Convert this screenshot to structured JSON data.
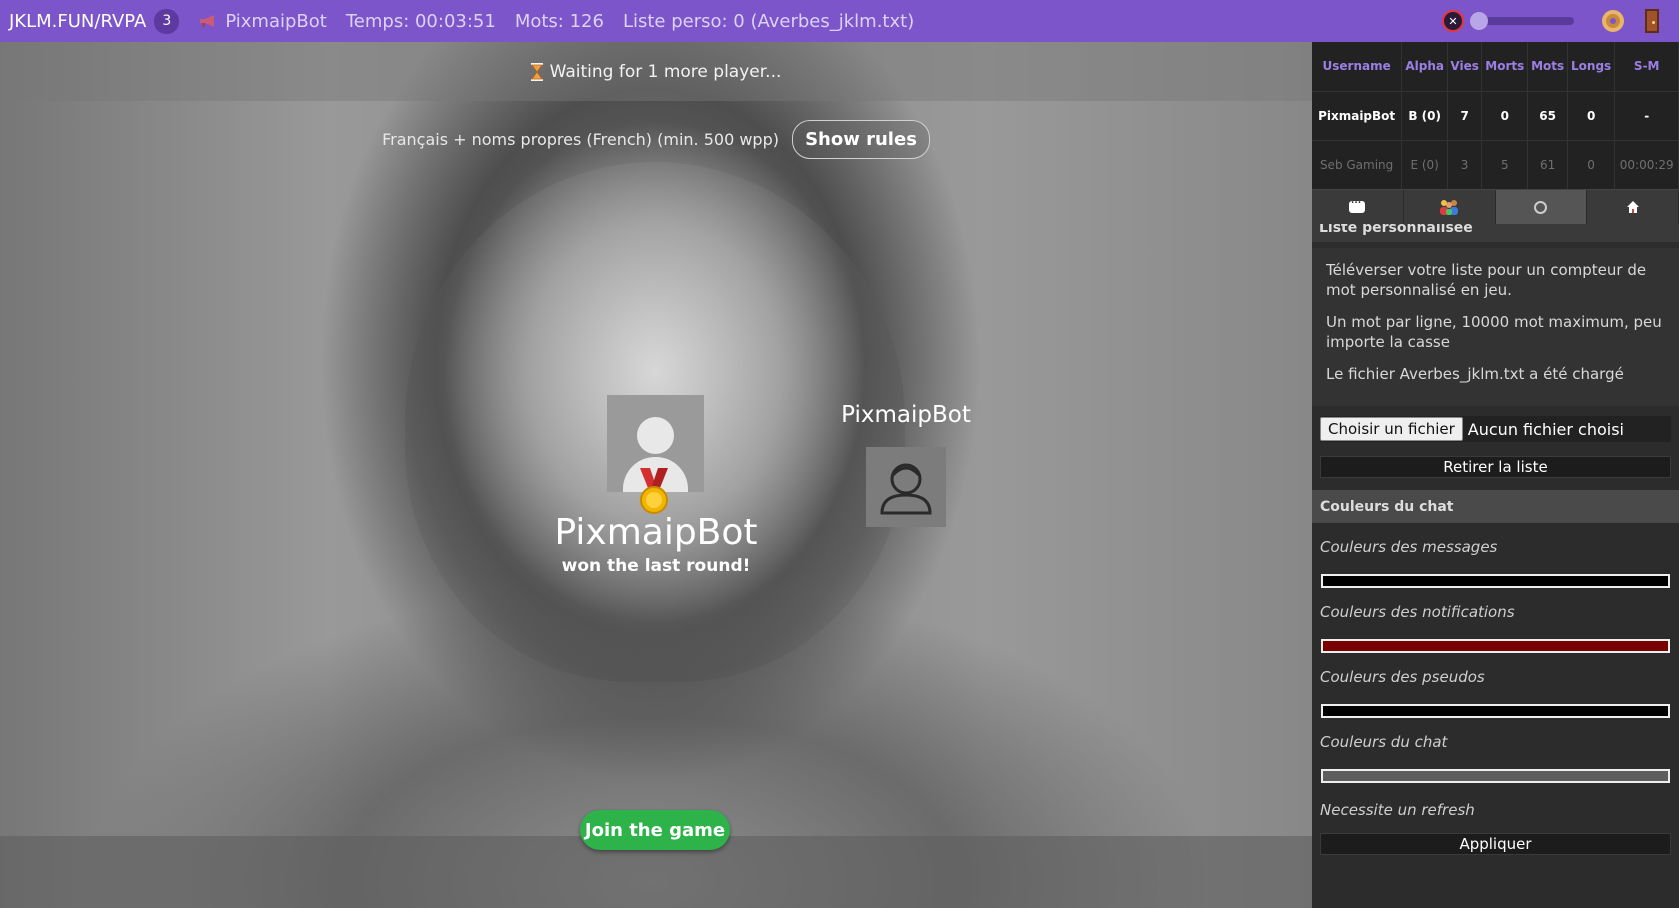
{
  "topbar": {
    "room": "JKLM.FUN/RVPA",
    "player_count": "3",
    "bot_name": "PixmaipBot",
    "temps": "Temps: 00:03:51",
    "mots": "Mots: 126",
    "liste": "Liste perso: 0 (Averbes_jklm.txt)",
    "volume_fraction": 0.0
  },
  "stage": {
    "status": "Waiting for 1 more player...",
    "rules_text": "Français + noms propres (French) (min. 500 wpp)",
    "show_rules": "Show rules",
    "winner_name": "PixmaipBot",
    "winner_sub": "won the last round!",
    "player_name": "PixmaipBot",
    "join_button": "Join the game"
  },
  "scoreboard": {
    "headers": [
      "Username",
      "Alpha",
      "Vies",
      "Morts",
      "Mots",
      "Longs",
      "S-M"
    ],
    "rows": [
      [
        "PixmaipBot",
        "B (0)",
        "7",
        "0",
        "65",
        "0",
        "-"
      ],
      [
        "Seb Gaming",
        "E (0)",
        "3",
        "5",
        "61",
        "0",
        "00:00:29"
      ]
    ]
  },
  "panel": {
    "liste_heading": "Liste personnalisée",
    "desc1": "Téléverser votre liste pour un compteur de mot personnalisé en jeu.",
    "desc2": "Un mot par ligne, 10000 mot maximum, peu importe la casse",
    "desc3": "Le fichier Averbes_jklm.txt a été chargé",
    "file_button": "Choisir un fichier",
    "file_status": "Aucun fichier choisi",
    "remove_button": "Retirer la liste",
    "colors_heading": "Couleurs du chat",
    "color_messages": "Couleurs des messages",
    "color_notifications": "Couleurs des notifications",
    "color_pseudos": "Couleurs des pseudos",
    "color_chat": "Couleurs du chat",
    "refresh_note": "Necessite un refresh",
    "apply_button": "Appliquer"
  },
  "colors": {
    "accent": "#7b55c9",
    "join_green": "#2db34a",
    "messages_swatch": "#000000",
    "notifications_swatch": "#7a0000",
    "pseudos_swatch": "#000000",
    "chat_swatch": "#5e5e5e"
  }
}
